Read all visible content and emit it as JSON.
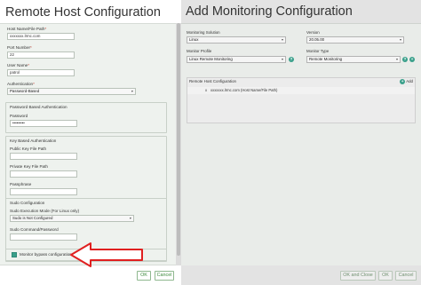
{
  "left_dialog": {
    "title": "Remote Host Configuration",
    "fields": {
      "host_label": "Host Name/File Path",
      "host_value": "xxxxxxx.lrmc.com",
      "port_label": "Port Number",
      "port_value": "22",
      "user_label": "User Name",
      "user_value": "patrol",
      "auth_label": "Authentication",
      "auth_value": "Password-Based",
      "required_mark": "*"
    },
    "password_group": {
      "title": "Password Based Authentication",
      "password_label": "Password",
      "password_value": "•••••••••"
    },
    "key_group": {
      "title": "Key Based Authentication",
      "public_key_label": "Public Key File Path",
      "private_key_label": "Private Key File Path",
      "passphrase_label": "Passphrase"
    },
    "sudo_group": {
      "title": "Sudo Configuration",
      "mode_label": "Sudo Execution Mode (For Linux only)",
      "mode_value": "Sudo is Not Configured",
      "command_label": "Sudo Command/Password"
    },
    "monitor_bypass_label": "Monitor bypass configuration",
    "buttons": {
      "ok": "OK",
      "cancel": "Cancel"
    },
    "caret": "▾"
  },
  "right_dialog": {
    "title": "Add Monitoring Configuration",
    "monitoring_solution_label": "Monitoring Solution",
    "monitoring_solution_value": "Linux",
    "version_label": "Version",
    "version_value": "20.05.00",
    "monitor_profile_label": "Monitor Profile",
    "monitor_profile_value": "Linux Remote Monitoring",
    "monitor_type_label": "Monitor Type",
    "monitor_type_value": "Remote Monitoring",
    "rhc_title": "Remote Host Configuration",
    "add_label": "Add",
    "row_remove": "x",
    "row_text": "xxxxxxx.lrmc.com (Host Name/File Path)",
    "help_glyph": "?",
    "plus_glyph": "+",
    "buttons": {
      "ok_close": "OK and Close",
      "ok": "OK",
      "cancel": "Cancel"
    },
    "caret": "▾"
  },
  "colors": {
    "accent": "#3aa08b",
    "arrow": "#e02020",
    "button_text": "#3c8a3c"
  }
}
